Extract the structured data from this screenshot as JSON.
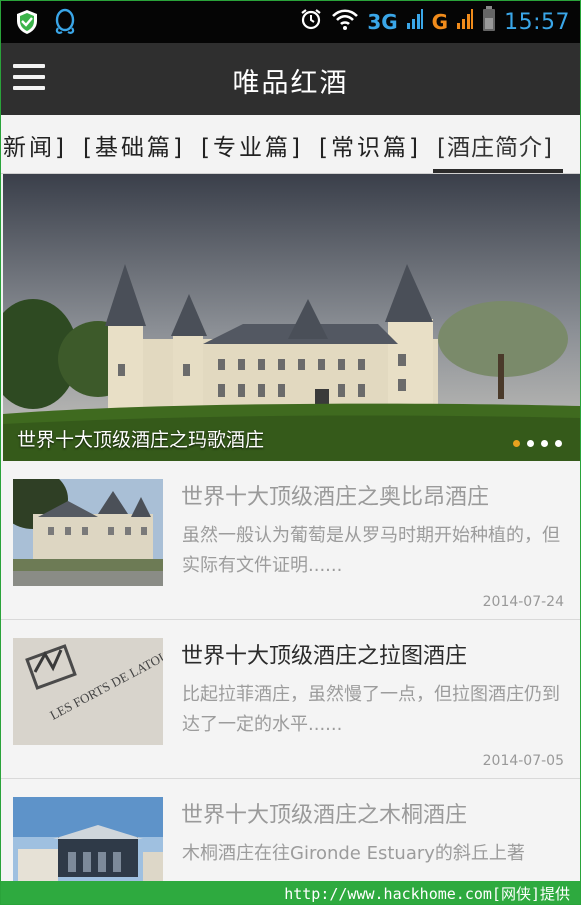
{
  "status_bar": {
    "left_icons": [
      "shield-icon",
      "qq-penguin-icon"
    ],
    "network_3g": "3G",
    "network_g": "G",
    "time": "15:57",
    "colors": {
      "accent": "#3aa6e8",
      "g_network": "#f08b1b"
    }
  },
  "app_bar": {
    "title": "唯品红酒",
    "menu_icon": "hamburger-menu-icon",
    "background": "#2f2f2f"
  },
  "tabs": [
    {
      "label": "新闻]"
    },
    {
      "label": "[基础篇]"
    },
    {
      "label": "[专业篇]"
    },
    {
      "label": "[常识篇]"
    },
    {
      "label": "[酒庄简介]",
      "active": true
    }
  ],
  "banner": {
    "caption": "世界十大顶级酒庄之玛歌酒庄",
    "slide_count": 4,
    "active_slide": 1
  },
  "articles": [
    {
      "title": "世界十大顶级酒庄之奥比昂酒庄",
      "summary": "虽然一般认为葡萄是从罗马时期开始种植的，但实际有文件证明......",
      "date": "2014-07-24"
    },
    {
      "title": "世界十大顶级酒庄之拉图酒庄",
      "summary": "比起拉菲酒庄，虽然慢了一点，但拉图酒庄仍到达了一定的水平......",
      "date": "2014-07-05",
      "thumb_text": "LES FORTS DE LATOUR"
    },
    {
      "title": "世界十大顶级酒庄之木桐酒庄",
      "summary": "木桐酒庄在往Gironde Estuary的斜丘上著",
      "date": ""
    }
  ],
  "watermark": {
    "text": "http://www.hackhome.com[网侠]提供",
    "color": "#2eaa3f"
  }
}
